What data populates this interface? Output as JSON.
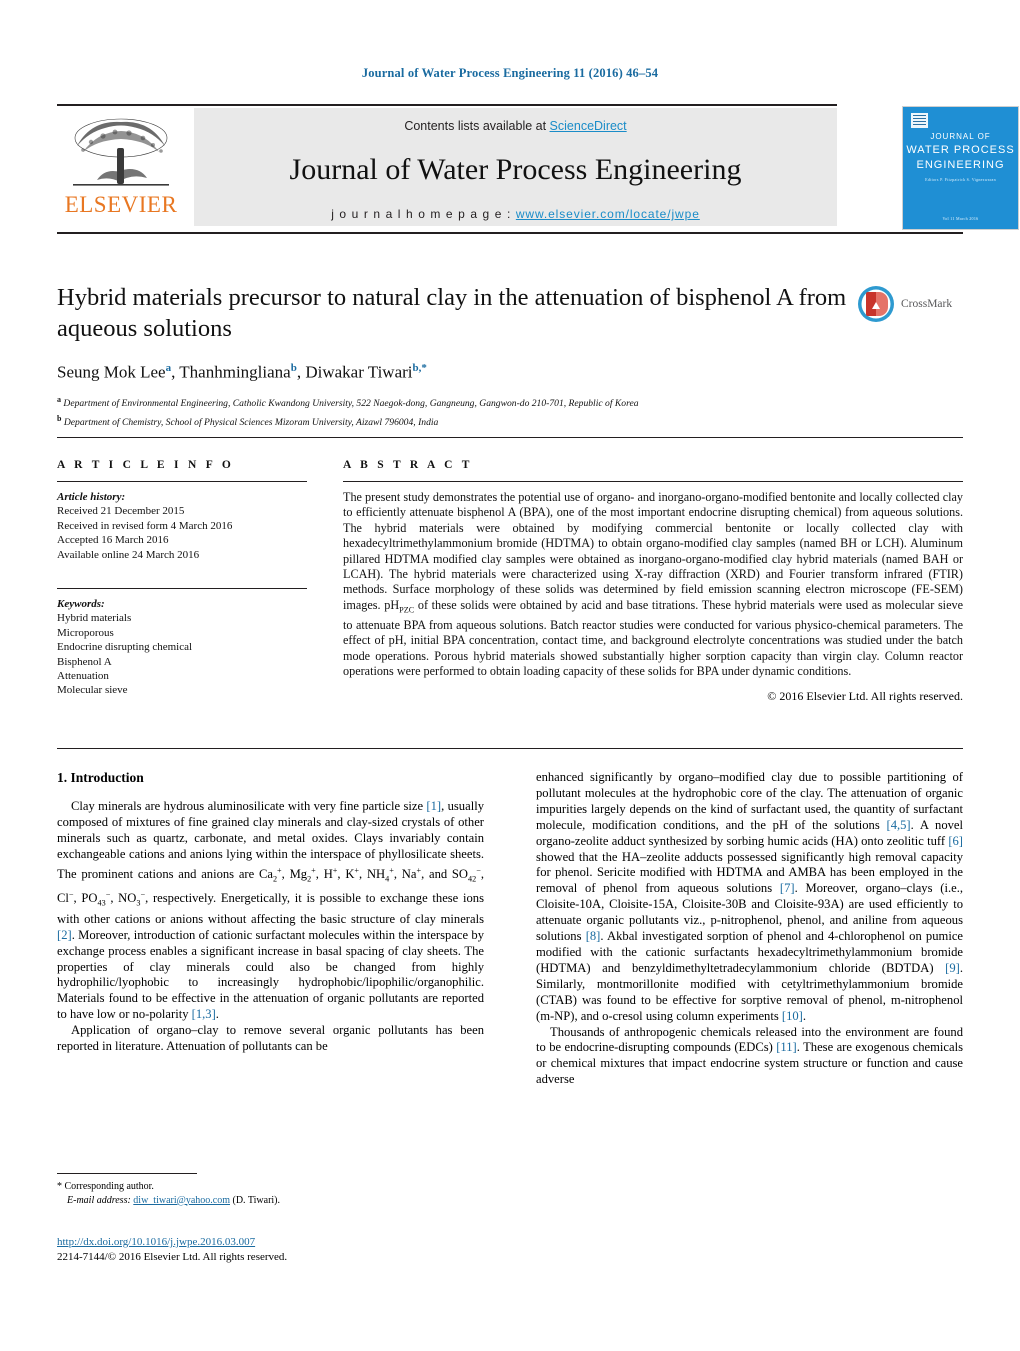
{
  "running_head": "Journal of Water Process Engineering 11 (2016) 46–54",
  "masthead": {
    "contents_prefix": "Contents lists available at ",
    "sciencedirect": "ScienceDirect",
    "journal_name": "Journal of Water Process Engineering",
    "homepage_prefix": "j o u r n a l   h o m e p a g e :  ",
    "homepage_url": "www.elsevier.com/locate/jwpe",
    "publisher": "ELSEVIER",
    "cover": {
      "line1": "JOURNAL OF",
      "line2": "WATER PROCESS",
      "line3": "ENGINEERING",
      "subtitle": "Editors\nP. Fitzpatrick   S.  Vigneswaran",
      "footer": "Vol 11  March 2016"
    }
  },
  "article": {
    "title": "Hybrid materials precursor to natural clay in the attenuation of bisphenol A from aqueous solutions",
    "authors_html": "Seung Mok Lee<sup>a</sup>, Thanhmingliana<sup>b</sup>, Diwakar Tiwari<sup>b,*</sup>",
    "affiliation_a": "Department of Environmental Engineering, Catholic Kwandong University, 522 Naegok-dong, Gangneung, Gangwon-do 210-701, Republic of Korea",
    "affiliation_b": "Department of Chemistry, School of Physical Sciences Mizoram University, Aizawl 796004, India",
    "crossmark_label": "CrossMark"
  },
  "info": {
    "heading": "A R T I C L E   I N F O",
    "history_label": "Article history:",
    "history": [
      "Received 21 December 2015",
      "Received in revised form 4 March 2016",
      "Accepted 16 March 2016",
      "Available online 24 March 2016"
    ],
    "keywords_label": "Keywords:",
    "keywords": [
      "Hybrid materials",
      "Microporous",
      "Endocrine disrupting chemical",
      "Bisphenol A",
      "Attenuation",
      "Molecular sieve"
    ]
  },
  "abstract": {
    "heading": "A B S T R A C T",
    "text": "The present study demonstrates the potential use of organo- and inorgano-organo-modified bentonite and locally collected clay to efficiently attenuate bisphenol A (BPA), one of the most important endocrine disrupting chemical) from aqueous solutions. The hybrid materials were obtained by modifying commercial bentonite or locally collected clay with hexadecyltrimethylammonium bromide (HDTMA) to obtain organo-modified clay samples (named BH or LCH). Aluminum pillared HDTMA modified clay samples were obtained as inorgano-organo-modified clay hybrid materials (named BAH or LCAH). The hybrid materials were characterized using X-ray diffraction (XRD) and Fourier transform infrared (FTIR) methods. Surface morphology of these solids was determined by field emission scanning electron microscope (FE-SEM) images. pHPZC of these solids were obtained by acid and base titrations. These hybrid materials were used as molecular sieve to attenuate BPA from aqueous solutions. Batch reactor studies were conducted for various physico-chemical parameters. The effect of pH, initial BPA concentration, contact time, and background electrolyte concentrations was studied under the batch mode operations. Porous hybrid materials showed substantially higher sorption capacity than virgin clay. Column reactor operations were performed to obtain loading capacity of these solids for BPA under dynamic conditions.",
    "copyright": "© 2016 Elsevier Ltd. All rights reserved."
  },
  "body": {
    "section_heading": "1.  Introduction",
    "left_paragraphs": [
      "Clay minerals are hydrous aluminosilicate with very fine particle size [1], usually composed of mixtures of fine grained clay minerals and clay-sized crystals of other minerals such as quartz, carbonate, and metal oxides. Clays invariably contain exchangeable cations and anions lying within the interspace of phyllosilicate sheets. The prominent cations and anions are Ca2+, Mg2+, H+, K+, NH4+, Na+, and SO42−, Cl−, PO43−, NO3−, respectively. Energetically, it is possible to exchange these ions with other cations or anions without affecting the basic structure of clay minerals [2]. Moreover, introduction of cationic surfactant molecules within the interspace by exchange process enables a significant increase in basal spacing of clay sheets. The properties of clay minerals could also be changed from highly hydrophilic/lyophobic to increasingly hydrophobic/lipophilic/organophilic. Materials found to be effective in the attenuation of organic pollutants are reported to have low or no-polarity [1,3].",
      "Application of organo–clay to remove several organic pollutants has been reported in literature. Attenuation of pollutants can be"
    ],
    "right_paragraphs": [
      "enhanced significantly by organo–modified clay due to possible partitioning of pollutant molecules at the hydrophobic core of the clay. The attenuation of organic impurities largely depends on the kind of surfactant used, the quantity of surfactant molecule, modification conditions, and the pH of the solutions [4,5]. A novel organo-zeolite adduct synthesized by sorbing humic acids (HA) onto zeolitic tuff [6] showed that the HA–zeolite adducts possessed significantly high removal capacity for phenol. Sericite modified with HDTMA and AMBA has been employed in the removal of phenol from aqueous solutions [7]. Moreover, organo–clays (i.e., Cloisite-10A, Cloisite-15A, Cloisite-30B and Cloisite-93A) are used efficiently to attenuate organic pollutants viz., p-nitrophenol, phenol, and aniline from aqueous solutions [8]. Akbal investigated sorption of phenol and 4-chlorophenol on pumice modified with the cationic surfactants hexadecyltrimethylammonium bromide (HDTMA) and benzyldimethyltetradecylammonium chloride (BDTDA) [9]. Similarly, montmorillonite modified with cetyltrimethylammonium bromide (CTAB) was found to be effective for sorptive removal of phenol, m-nitrophenol (m-NP), and o-cresol using column experiments [10].",
      "Thousands of anthropogenic chemicals released into the environment are found to be endocrine-disrupting compounds (EDCs) [11]. These are exogenous chemicals or chemical mixtures that impact endocrine system structure or function and cause adverse"
    ]
  },
  "footer": {
    "corresponding_marker": "*",
    "corresponding_label": "Corresponding author.",
    "email_label": "E-mail address:",
    "email": "diw_tiwari@yahoo.com",
    "email_suffix": "(D. Tiwari).",
    "doi_url": "http://dx.doi.org/10.1016/j.jwpe.2016.03.007",
    "issn_line": "2214-7144/© 2016 Elsevier Ltd. All rights reserved."
  },
  "colors": {
    "link_blue": "#1a6ba0",
    "sciencedirect_blue": "#1a8cc8",
    "elsevier_orange": "#e87722",
    "cover_blue": "#1f8fd4"
  }
}
